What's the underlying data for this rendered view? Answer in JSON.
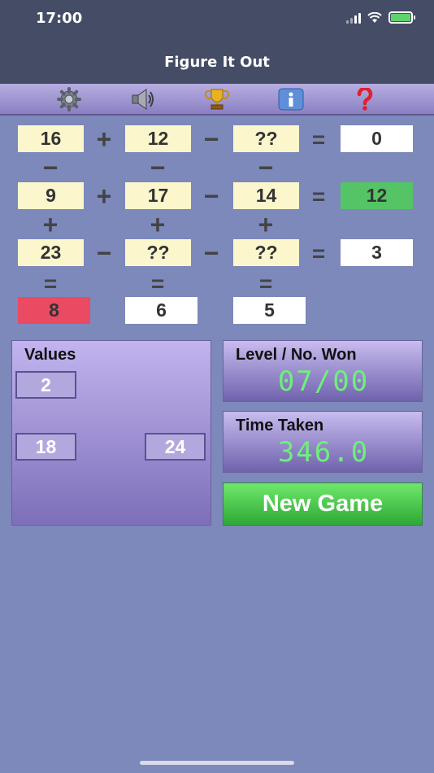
{
  "status_bar": {
    "time": "17:00"
  },
  "header": {
    "title": "Figure It Out"
  },
  "toolbar": {
    "icons": [
      "gear-icon",
      "speaker-icon",
      "trophy-icon",
      "info-icon",
      "question-icon"
    ]
  },
  "grid": {
    "rows": [
      {
        "cells": [
          "16",
          "12",
          "??"
        ],
        "ops": [
          "+",
          "−"
        ],
        "equals": "=",
        "result": "0",
        "result_state": "neutral"
      },
      {
        "cells": [
          "9",
          "17",
          "14"
        ],
        "ops": [
          "+",
          "−"
        ],
        "equals": "=",
        "result": "12",
        "result_state": "correct"
      },
      {
        "cells": [
          "23",
          "??",
          "??"
        ],
        "ops": [
          "−",
          "−"
        ],
        "equals": "=",
        "result": "3",
        "result_state": "neutral"
      }
    ],
    "col_ops_1": [
      "−",
      "−",
      "−"
    ],
    "col_ops_2": [
      "+",
      "+",
      "+"
    ],
    "col_equals": [
      "=",
      "=",
      "="
    ],
    "col_results": [
      {
        "value": "8",
        "state": "wrong"
      },
      {
        "value": "6",
        "state": "neutral"
      },
      {
        "value": "5",
        "state": "neutral"
      }
    ]
  },
  "values_panel": {
    "label": "Values",
    "tiles": [
      "2",
      "18",
      "24"
    ]
  },
  "level_panel": {
    "label": "Level / No. Won",
    "value": "07/00"
  },
  "time_panel": {
    "label": "Time Taken",
    "value": "346.0"
  },
  "new_game": {
    "label": "New Game"
  },
  "colors": {
    "background": "#7d88bb",
    "correct": "#55c466",
    "wrong": "#ea4a62",
    "digital": "#6ef07a"
  }
}
